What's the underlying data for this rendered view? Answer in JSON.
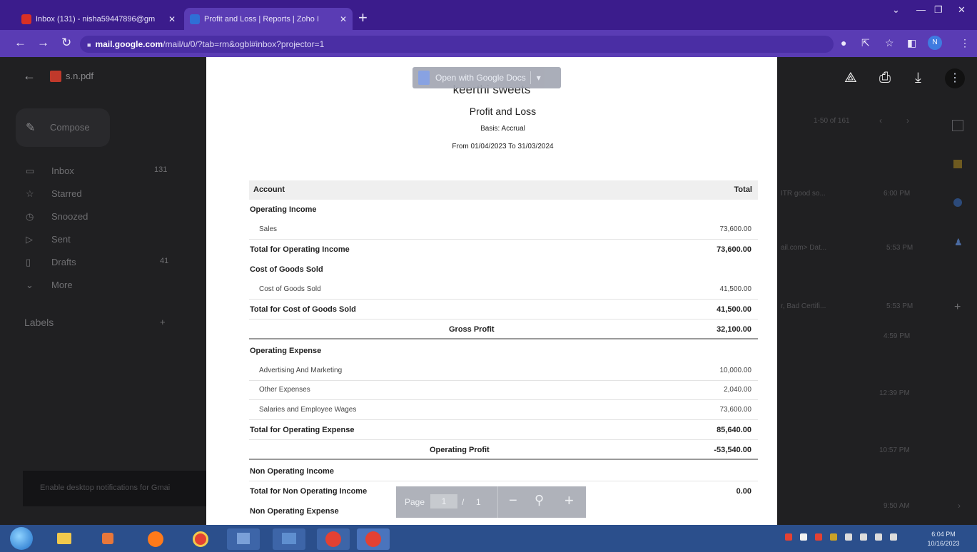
{
  "browser": {
    "tabs": [
      {
        "title": "Inbox (131) - nisha59447896@gm",
        "favicon_color": "#d93025"
      },
      {
        "title": "Profit and Loss | Reports | Zoho I",
        "favicon_color": "#2f6fd6"
      }
    ],
    "url_host": "mail.google.com",
    "url_path": "/mail/u/0/?tab=rm&ogbl#inbox?projector=1"
  },
  "gmail_background": {
    "file_name": "s.n.pdf",
    "compose": "Compose",
    "nav": [
      {
        "label": "Inbox",
        "count": "131"
      },
      {
        "label": "Starred",
        "count": ""
      },
      {
        "label": "Snoozed",
        "count": ""
      },
      {
        "label": "Sent",
        "count": ""
      },
      {
        "label": "Drafts",
        "count": "41"
      },
      {
        "label": "More",
        "count": ""
      }
    ],
    "labels_heading": "Labels",
    "notification": "Enable desktop notifications for Gmai",
    "pager": "1-50 of 161",
    "email_snippets": [
      "ITR good so...",
      "ail.com> Dat...",
      "r, Bad Certifi..."
    ],
    "times": [
      "6:00 PM",
      "5:53 PM",
      "5:53 PM",
      "4:59 PM",
      "12:39 PM",
      "10:57 PM",
      "9:50 AM"
    ]
  },
  "viewer": {
    "open_with": "Open with Google Docs",
    "page_label": "Page",
    "page_current": "1",
    "page_sep": "/",
    "page_total": "1"
  },
  "report": {
    "company": "keerthi sweets",
    "title": "Profit and Loss",
    "basis": "Basis: Accrual",
    "period": "From 01/04/2023 To 31/03/2024",
    "col_account": "Account",
    "col_total": "Total",
    "rows": [
      {
        "account": "Operating Income",
        "value": "",
        "kind": "section"
      },
      {
        "account": "Sales",
        "value": "73,600.00",
        "kind": "item"
      },
      {
        "account": "Total for Operating Income",
        "value": "73,600.00",
        "kind": "total"
      },
      {
        "account": "Cost of Goods Sold",
        "value": "",
        "kind": "section"
      },
      {
        "account": "Cost of Goods Sold",
        "value": "41,500.00",
        "kind": "item"
      },
      {
        "account": "Total for Cost of Goods Sold",
        "value": "41,500.00",
        "kind": "total"
      },
      {
        "account": "Gross Profit",
        "value": "32,100.00",
        "kind": "profit"
      },
      {
        "account": "Operating Expense",
        "value": "",
        "kind": "section"
      },
      {
        "account": "Advertising And Marketing",
        "value": "10,000.00",
        "kind": "item"
      },
      {
        "account": "Other Expenses",
        "value": "2,040.00",
        "kind": "item"
      },
      {
        "account": "Salaries and Employee Wages",
        "value": "73,600.00",
        "kind": "item"
      },
      {
        "account": "Total for Operating Expense",
        "value": "85,640.00",
        "kind": "total"
      },
      {
        "account": "Operating Profit",
        "value": "-53,540.00",
        "kind": "profit"
      },
      {
        "account": "Non Operating Income",
        "value": "",
        "kind": "section"
      },
      {
        "account": "Total for Non Operating Income",
        "value": "0.00",
        "kind": "total"
      },
      {
        "account": "Non Operating Expense",
        "value": "",
        "kind": "section"
      }
    ]
  },
  "taskbar": {
    "clock_time": "6:04 PM",
    "clock_date": "10/16/2023",
    "app_colors": [
      "#3a78d8",
      "#f2c94c",
      "#e8773a",
      "#ff7a1a",
      "#e34133",
      "#7aa0d8",
      "#5f8fcf",
      "#e34133",
      "#e34133"
    ]
  },
  "colors": {
    "tabbar": "#3b1c8c",
    "toolbar": "#5a3cb4",
    "taskbar": "#2b4f8c"
  }
}
